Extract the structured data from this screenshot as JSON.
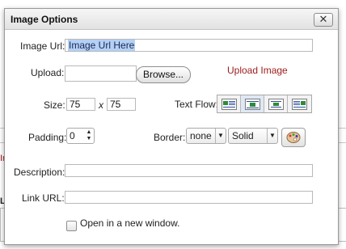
{
  "dialog": {
    "title": "Image Options",
    "close_label": "✕"
  },
  "fields": {
    "image_url_label": "Image Url:",
    "image_url_value": "Image Url Here",
    "upload_label": "Upload:",
    "browse_label": "Browse...",
    "upload_image_link": "Upload Image",
    "size_label": "Size:",
    "width_value": "75",
    "size_separator": "x",
    "height_value": "75",
    "text_flow_label": "Text Flow:",
    "padding_label": "Padding:",
    "padding_value": "0",
    "border_label": "Border:",
    "border_width_value": "none",
    "border_style_value": "Solid",
    "description_label": "Description:",
    "link_url_label": "Link URL:",
    "new_window_label": "Open in a new window."
  },
  "background_text": {
    "frag_in": "In",
    "frag_l": "L"
  },
  "colors": {
    "link": "#9c1a1a",
    "selection": "#b4d0f5",
    "active_flow": "#dfe8f3"
  },
  "icons": {
    "text_flow": [
      "align-left-icon",
      "align-inline-icon",
      "align-center-icon",
      "align-right-icon"
    ],
    "border_color": "palette-icon"
  }
}
